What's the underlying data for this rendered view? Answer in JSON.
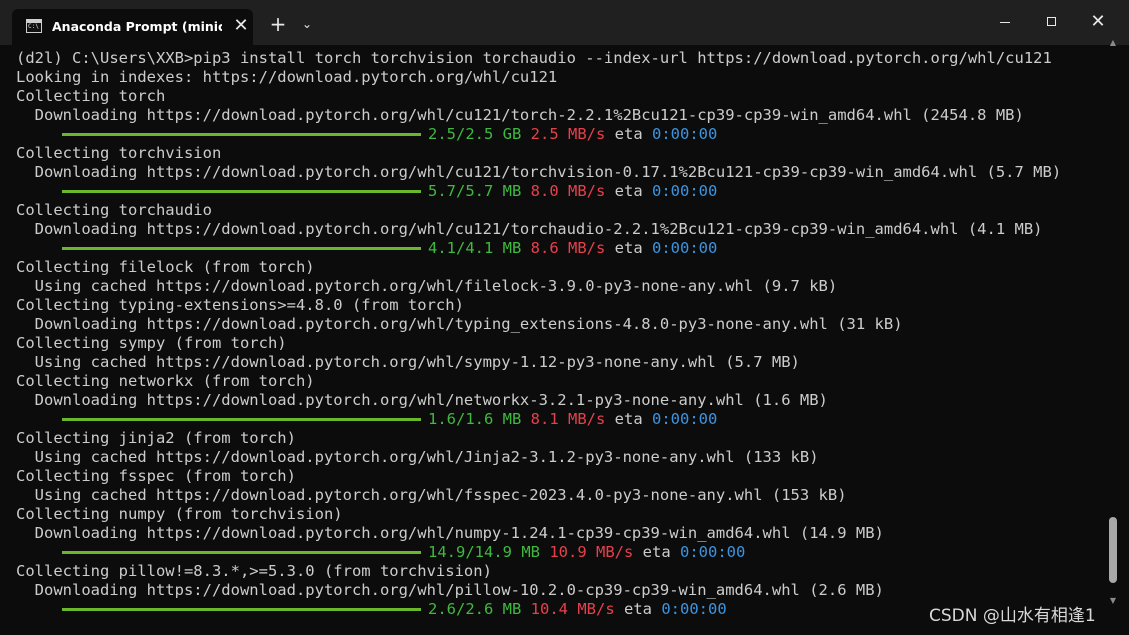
{
  "window": {
    "tab_title": "Anaconda Prompt (miniconda",
    "tab_close": "✕",
    "new_tab": "+",
    "dropdown": "⌄",
    "close": "✕"
  },
  "terminal": {
    "lines": [
      {
        "text": "(d2l) C:\\Users\\XXB>pip3 install torch torchvision torchaudio --index-url https://download.pytorch.org/whl/cu121"
      },
      {
        "text": "Looking in indexes: https://download.pytorch.org/whl/cu121"
      },
      {
        "text": "Collecting torch"
      },
      {
        "text": "  Downloading https://download.pytorch.org/whl/cu121/torch-2.2.1%2Bcu121-cp39-cp39-win_amd64.whl (2454.8 MB)"
      },
      {
        "progress": true,
        "size": "2.5/2.5 GB",
        "speed": "2.5 MB/s",
        "eta_label": "eta",
        "eta": "0:00:00",
        "fraction": 1.0
      },
      {
        "text": "Collecting torchvision"
      },
      {
        "text": "  Downloading https://download.pytorch.org/whl/cu121/torchvision-0.17.1%2Bcu121-cp39-cp39-win_amd64.whl (5.7 MB)"
      },
      {
        "progress": true,
        "size": "5.7/5.7 MB",
        "speed": "8.0 MB/s",
        "eta_label": "eta",
        "eta": "0:00:00",
        "fraction": 1.0
      },
      {
        "text": "Collecting torchaudio"
      },
      {
        "text": "  Downloading https://download.pytorch.org/whl/cu121/torchaudio-2.2.1%2Bcu121-cp39-cp39-win_amd64.whl (4.1 MB)"
      },
      {
        "progress": true,
        "size": "4.1/4.1 MB",
        "speed": "8.6 MB/s",
        "eta_label": "eta",
        "eta": "0:00:00",
        "fraction": 1.0
      },
      {
        "text": "Collecting filelock (from torch)"
      },
      {
        "text": "  Using cached https://download.pytorch.org/whl/filelock-3.9.0-py3-none-any.whl (9.7 kB)"
      },
      {
        "text": "Collecting typing-extensions>=4.8.0 (from torch)"
      },
      {
        "text": "  Downloading https://download.pytorch.org/whl/typing_extensions-4.8.0-py3-none-any.whl (31 kB)"
      },
      {
        "text": "Collecting sympy (from torch)"
      },
      {
        "text": "  Using cached https://download.pytorch.org/whl/sympy-1.12-py3-none-any.whl (5.7 MB)"
      },
      {
        "text": "Collecting networkx (from torch)"
      },
      {
        "text": "  Downloading https://download.pytorch.org/whl/networkx-3.2.1-py3-none-any.whl (1.6 MB)"
      },
      {
        "progress": true,
        "size": "1.6/1.6 MB",
        "speed": "8.1 MB/s",
        "eta_label": "eta",
        "eta": "0:00:00",
        "fraction": 1.0
      },
      {
        "text": "Collecting jinja2 (from torch)"
      },
      {
        "text": "  Using cached https://download.pytorch.org/whl/Jinja2-3.1.2-py3-none-any.whl (133 kB)"
      },
      {
        "text": "Collecting fsspec (from torch)"
      },
      {
        "text": "  Using cached https://download.pytorch.org/whl/fsspec-2023.4.0-py3-none-any.whl (153 kB)"
      },
      {
        "text": "Collecting numpy (from torchvision)"
      },
      {
        "text": "  Downloading https://download.pytorch.org/whl/numpy-1.24.1-cp39-cp39-win_amd64.whl (14.9 MB)"
      },
      {
        "progress": true,
        "size": "14.9/14.9 MB",
        "speed": "10.9 MB/s",
        "eta_label": "eta",
        "eta": "0:00:00",
        "fraction": 1.0
      },
      {
        "text": "Collecting pillow!=8.3.*,>=5.3.0 (from torchvision)"
      },
      {
        "text": "  Downloading https://download.pytorch.org/whl/pillow-10.2.0-cp39-cp39-win_amd64.whl (2.6 MB)"
      },
      {
        "progress": true,
        "size": "2.6/2.6 MB",
        "speed": "10.4 MB/s",
        "eta_label": "eta",
        "eta": "0:00:00",
        "fraction": 1.0
      }
    ]
  },
  "watermark": "CSDN @山水有相逢1",
  "colors": {
    "progress_bar": "#6ab72c",
    "size": "#3fb93f",
    "speed": "#e8404b",
    "eta": "#3b95e0",
    "text": "#cccccc",
    "background": "#0c0c0c",
    "titlebar": "#202020"
  }
}
